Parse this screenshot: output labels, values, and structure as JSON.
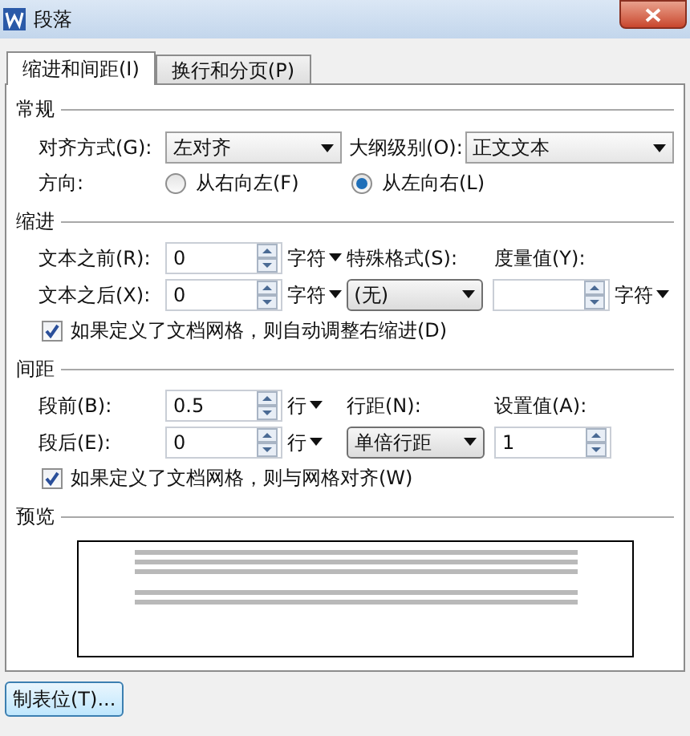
{
  "window": {
    "title": "段落"
  },
  "tabs": [
    {
      "label": "缩进和间距(I)",
      "selected": true
    },
    {
      "label": "换行和分页(P)",
      "selected": false
    }
  ],
  "general": {
    "heading": "常规",
    "alignment": {
      "label": "对齐方式(G):",
      "value": "左对齐"
    },
    "outline_level": {
      "label": "大纲级别(O):",
      "value": "正文文本"
    },
    "direction": {
      "label": "方向:",
      "options": [
        {
          "label": "从右向左(F)",
          "selected": false
        },
        {
          "label": "从左向右(L)",
          "selected": true
        }
      ]
    }
  },
  "indent": {
    "heading": "缩进",
    "before": {
      "label": "文本之前(R):",
      "value": "0",
      "unit": "字符"
    },
    "after": {
      "label": "文本之后(X):",
      "value": "0",
      "unit": "字符"
    },
    "special": {
      "label": "特殊格式(S):",
      "value": "(无)"
    },
    "measure": {
      "label": "度量值(Y):",
      "unit": "字符"
    },
    "grid_option": {
      "label": "如果定义了文档网格，则自动调整右缩进(D)",
      "checked": true
    }
  },
  "spacing": {
    "heading": "间距",
    "before": {
      "label": "段前(B):",
      "value": "0.5",
      "unit": "行"
    },
    "after": {
      "label": "段后(E):",
      "value": "0",
      "unit": "行"
    },
    "line_spacing": {
      "label": "行距(N):",
      "value": "单倍行距"
    },
    "setting": {
      "label": "设置值(A):",
      "value": "1"
    },
    "grid_option": {
      "label": "如果定义了文档网格，则与网格对齐(W)",
      "checked": true
    }
  },
  "preview": {
    "heading": "预览"
  },
  "tab_stops_button": "制表位(T)..."
}
